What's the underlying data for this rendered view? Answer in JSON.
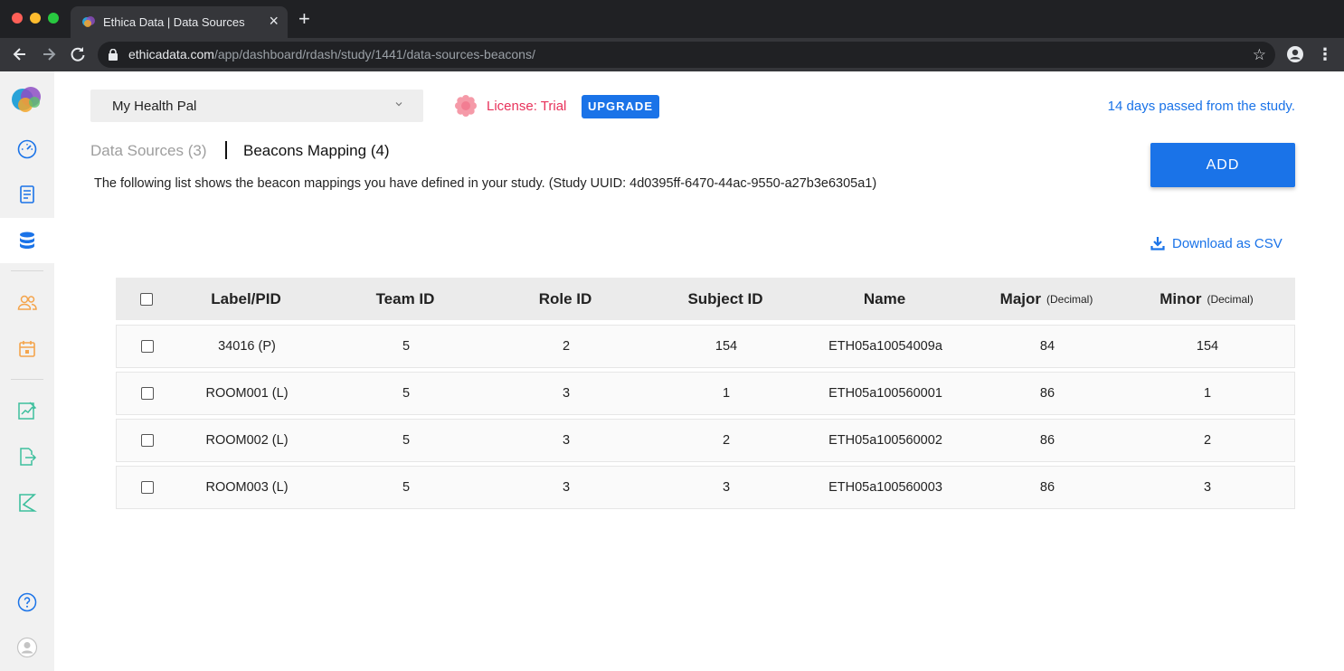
{
  "browser": {
    "tab_title": "Ethica Data | Data Sources",
    "tab_close": "×",
    "new_tab": "+",
    "url_host": "ethicadata.com",
    "url_path": "/app/dashboard/rdash/study/1441/data-sources-beacons/"
  },
  "sidebar": {
    "items": [
      "logo",
      "dashboard-icon",
      "survey-icon",
      "data-sources-icon",
      "participants-icon",
      "calendar-icon",
      "analytics-icon",
      "export-icon",
      "kendo-icon",
      "help-icon",
      "user-avatar"
    ],
    "active": "data-sources-icon"
  },
  "header": {
    "study_name": "My Health Pal",
    "license_text": "License: Trial",
    "upgrade_label": "UPGRADE",
    "days_passed": "14 days passed from the study."
  },
  "tabs": {
    "data_sources": "Data Sources (3)",
    "beacons_mapping": "Beacons Mapping (4)"
  },
  "description": "The following list shows the beacon mappings you have defined in your study. (Study UUID: 4d0395ff-6470-44ac-9550-a27b3e6305a1)",
  "actions": {
    "add_label": "ADD",
    "download_label": "Download as CSV"
  },
  "table": {
    "headers": {
      "label_pid": "Label/PID",
      "team_id": "Team ID",
      "role_id": "Role ID",
      "subject_id": "Subject ID",
      "name": "Name",
      "major": "Major",
      "major_unit": "(Decimal)",
      "minor": "Minor",
      "minor_unit": "(Decimal)"
    },
    "rows": [
      {
        "label": "34016 (P)",
        "team": "5",
        "role": "2",
        "subject": "154",
        "name": "ETH05a10054009a",
        "major": "84",
        "minor": "154"
      },
      {
        "label": "ROOM001 (L)",
        "team": "5",
        "role": "3",
        "subject": "1",
        "name": "ETH05a100560001",
        "major": "86",
        "minor": "1"
      },
      {
        "label": "ROOM002 (L)",
        "team": "5",
        "role": "3",
        "subject": "2",
        "name": "ETH05a100560002",
        "major": "86",
        "minor": "2"
      },
      {
        "label": "ROOM003 (L)",
        "team": "5",
        "role": "3",
        "subject": "3",
        "name": "ETH05a100560003",
        "major": "86",
        "minor": "3"
      }
    ]
  },
  "colors": {
    "accent": "#1a73e8",
    "license": "#e8325b"
  }
}
